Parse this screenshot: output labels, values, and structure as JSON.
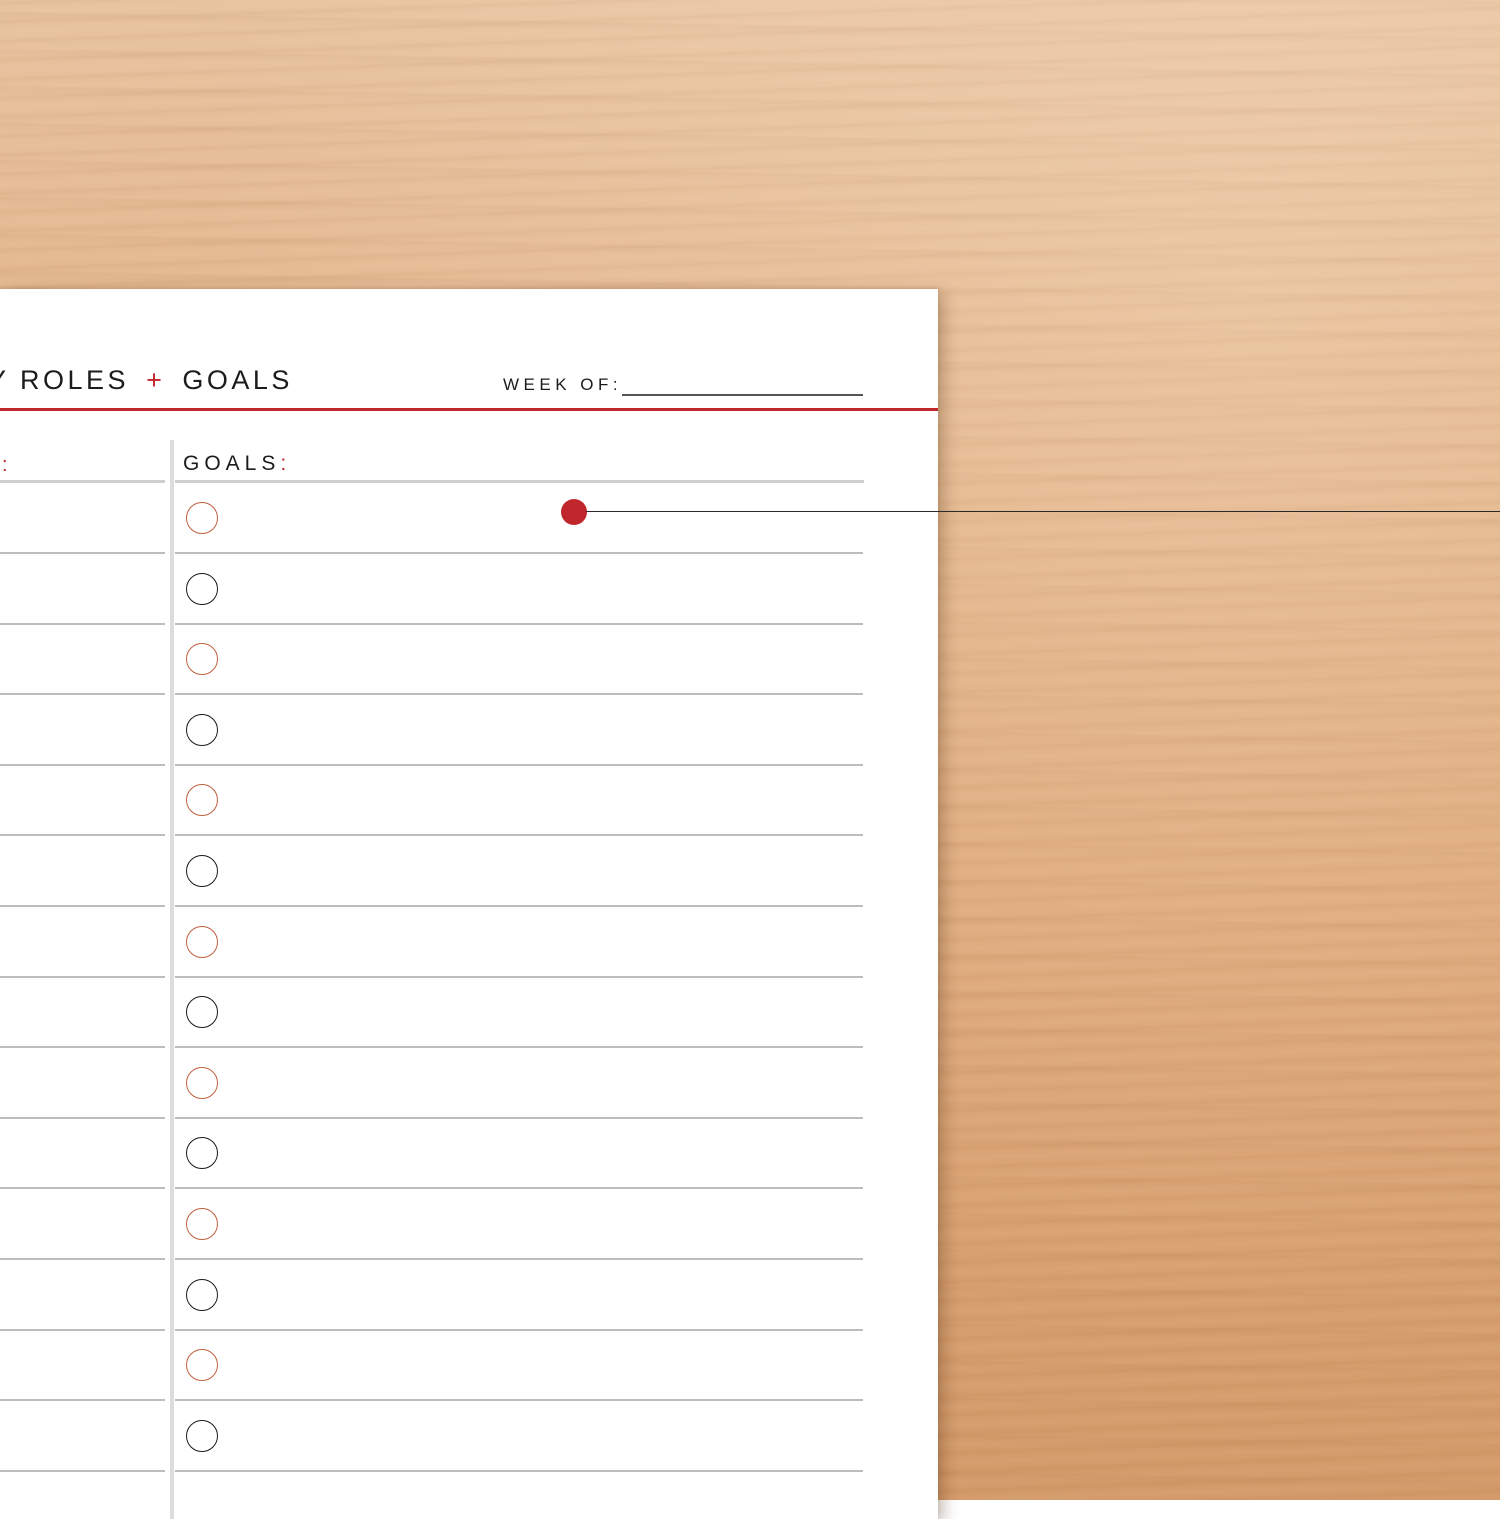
{
  "planner": {
    "title_part1": "Y ROLES",
    "title_plus": "+",
    "title_part2": "GOALS",
    "week_label": "WEEK OF:",
    "left_column_colon": ":",
    "goals_header": "GOALS",
    "goals_colon": ":",
    "goal_rows": [
      {
        "circle_color": "red"
      },
      {
        "circle_color": "black"
      },
      {
        "circle_color": "red"
      },
      {
        "circle_color": "black"
      },
      {
        "circle_color": "red"
      },
      {
        "circle_color": "black"
      },
      {
        "circle_color": "red"
      },
      {
        "circle_color": "black"
      },
      {
        "circle_color": "red"
      },
      {
        "circle_color": "black"
      },
      {
        "circle_color": "red"
      },
      {
        "circle_color": "black"
      },
      {
        "circle_color": "red"
      },
      {
        "circle_color": "black"
      }
    ]
  },
  "colors": {
    "accent_red": "#c0272d",
    "circle_red": "#c0603f",
    "ink": "#1c1c1c",
    "paper": "#ffffff",
    "wood": "#dda87a"
  },
  "icons": {
    "callout": "callout-dot-icon",
    "checkbox": "circle-checkbox-icon"
  }
}
